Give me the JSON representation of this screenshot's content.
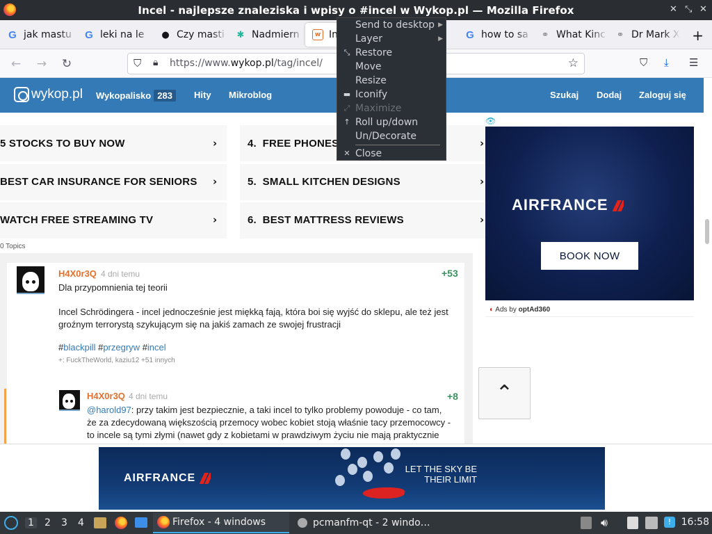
{
  "window": {
    "title": "Incel - najlepsze znaleziska i wpisy o #incel w Wykop.pl — Mozilla Firefox",
    "controls": [
      "×",
      "⤡",
      "×"
    ]
  },
  "tabs": [
    {
      "label": "jak mastu",
      "icon": "google-icon"
    },
    {
      "label": "leki na le",
      "icon": "google-icon"
    },
    {
      "label": "Czy masti",
      "icon": "paw-icon"
    },
    {
      "label": "Nadmiern",
      "icon": "leaf-icon"
    },
    {
      "label": "Inc",
      "icon": "wykop-icon"
    },
    {
      "label": "how to sa",
      "icon": "google-icon"
    },
    {
      "label": "What Kinc",
      "icon": "link-icon"
    },
    {
      "label": "Dr Mark X",
      "icon": "link-icon"
    }
  ],
  "tab_new_label": "+",
  "navbar": {
    "url_prefix": "https://www.",
    "url_domain": "wykop.pl",
    "url_path": "/tag/incel/"
  },
  "wykop": {
    "logo": "wykop.pl",
    "nav_left": [
      {
        "label": "Wykopalisko",
        "badge": "283"
      },
      {
        "label": "Hity"
      },
      {
        "label": "Mikroblog"
      }
    ],
    "nav_right": [
      "Szukaj",
      "Dodaj",
      "Zaloguj się"
    ]
  },
  "promos": {
    "left": [
      "5 STOCKS TO BUY NOW",
      "BEST CAR INSURANCE FOR SENIORS",
      "WATCH FREE STREAMING TV"
    ],
    "right": [
      {
        "num": "4.",
        "label": "FREE PHONES F"
      },
      {
        "num": "5.",
        "label": "SMALL KITCHEN DESIGNS"
      },
      {
        "num": "6.",
        "label": "BEST MATTRESS REVIEWS"
      }
    ],
    "chevron": "›",
    "footer": "0 Topics"
  },
  "post": {
    "author": "H4X0r3Q",
    "date": "4 dni temu",
    "votes": "+53",
    "line1": "Dla przypomnienia tej teorii",
    "body1": "Incel Schrödingera - incel jednocześnie jest miękką fają, która boi się wyjść do sklepu, ale też jest",
    "body2": "groźnym terrorystą szykującym się na jakiś zamach ze swojej frustracji",
    "tags": [
      "#blackpill",
      "#przegryw",
      "#incel"
    ],
    "tag_words": [
      "blackpill",
      "przegryw",
      "incel"
    ],
    "plus_prefix": "+:",
    "plus_users": "FuckTheWorld, kaziu12 +51 innych"
  },
  "reply": {
    "author": "H4X0r3Q",
    "date": "4 dni temu",
    "votes": "+8",
    "mention": "@harold97",
    "line1": ": przy takim jest bezpiecznie, a taki incel to tylko problemy powoduje - co tam,",
    "line2": "że za zdecydowaną większością przemocy wobec kobiet stoją właśnie tacy przemocowcy -",
    "line3": "to incele są tymi złymi (nawet gdy z kobietami w prawdziwym życiu nie mają praktycznie"
  },
  "side_ad": {
    "brand": "AIRFRANCE",
    "button": "BOOK NOW",
    "ads_by_prefix": "Ads by ",
    "ads_by_name": "optAd360"
  },
  "scrolltop_label": "⌃",
  "bottom_ad": {
    "brand": "AIRFRANCE",
    "slogan_line1": "LET THE SKY BE",
    "slogan_line2": "THEIR LIMIT"
  },
  "context_menu": [
    {
      "label": "Send to desktop",
      "submenu": true,
      "disabled": false,
      "glyph": ""
    },
    {
      "label": "Layer",
      "submenu": true,
      "disabled": false,
      "glyph": ""
    },
    {
      "label": "Restore",
      "submenu": false,
      "disabled": false,
      "glyph": "⤡"
    },
    {
      "label": "Move",
      "submenu": false,
      "disabled": false,
      "glyph": ""
    },
    {
      "label": "Resize",
      "submenu": false,
      "disabled": false,
      "glyph": ""
    },
    {
      "label": "Iconify",
      "submenu": false,
      "disabled": false,
      "glyph": "▬"
    },
    {
      "label": "Maximize",
      "submenu": false,
      "disabled": true,
      "glyph": "⤢"
    },
    {
      "label": "Roll up/down",
      "submenu": false,
      "disabled": false,
      "glyph": "↑"
    },
    {
      "label": "Un/Decorate",
      "submenu": false,
      "disabled": false,
      "glyph": ""
    },
    {
      "label": "Close",
      "submenu": false,
      "disabled": false,
      "glyph": "✕"
    }
  ],
  "taskbar": {
    "desktops": [
      "1",
      "2",
      "3",
      "4"
    ],
    "tasks": [
      {
        "label": "Firefox - 4 windows",
        "active": true
      },
      {
        "label": "pcmanfm-qt - 2 windo…",
        "active": false
      }
    ],
    "clock": "16:58"
  },
  "colors": {
    "wykop_blue": "#347ab7",
    "author_orange": "#e3702d",
    "vote_green": "#3b915f",
    "airfrance_red": "#e2231a"
  }
}
